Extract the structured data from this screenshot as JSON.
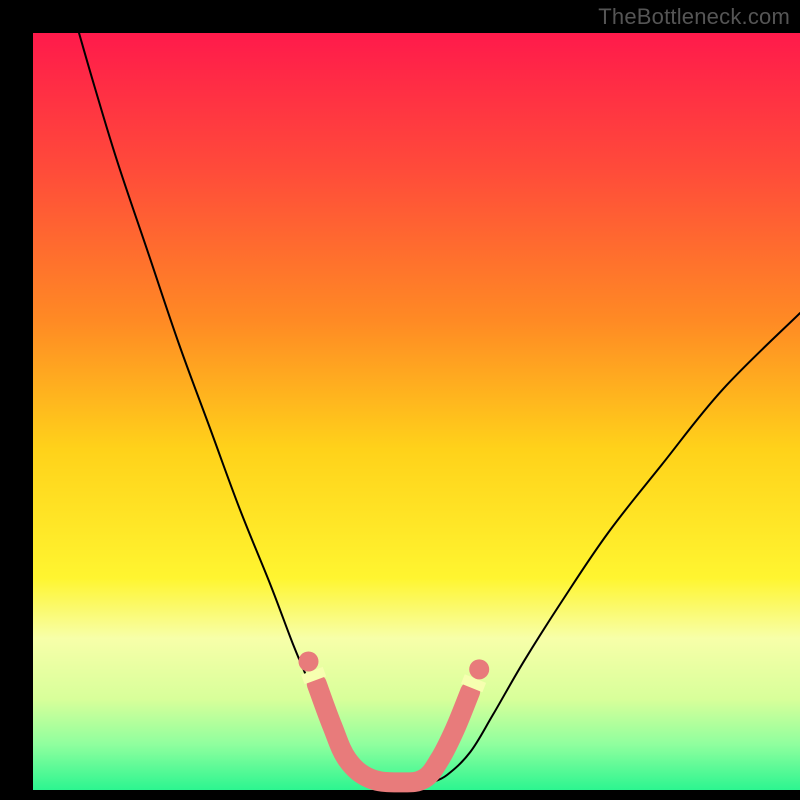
{
  "watermark": "TheBottleneck.com",
  "chart_data": {
    "type": "line",
    "title": "",
    "xlabel": "",
    "ylabel": "",
    "xlim": [
      0,
      100
    ],
    "ylim": [
      0,
      100
    ],
    "background_gradient": {
      "stops": [
        {
          "offset": 0.0,
          "color": "#ff1a4b"
        },
        {
          "offset": 0.18,
          "color": "#ff4b3a"
        },
        {
          "offset": 0.38,
          "color": "#ff8a24"
        },
        {
          "offset": 0.55,
          "color": "#ffd21a"
        },
        {
          "offset": 0.72,
          "color": "#fff530"
        },
        {
          "offset": 0.8,
          "color": "#f7ffa9"
        },
        {
          "offset": 0.88,
          "color": "#d8ff9a"
        },
        {
          "offset": 0.94,
          "color": "#8fff9e"
        },
        {
          "offset": 1.0,
          "color": "#2cf590"
        }
      ]
    },
    "series": [
      {
        "name": "left-curve",
        "type": "curve",
        "color": "#000000",
        "width": 2,
        "points": [
          {
            "x": 6.0,
            "y": 100.0
          },
          {
            "x": 8.0,
            "y": 93.0
          },
          {
            "x": 11.0,
            "y": 83.0
          },
          {
            "x": 15.0,
            "y": 71.0
          },
          {
            "x": 19.0,
            "y": 59.0
          },
          {
            "x": 23.0,
            "y": 48.0
          },
          {
            "x": 27.0,
            "y": 37.0
          },
          {
            "x": 31.0,
            "y": 27.0
          },
          {
            "x": 34.0,
            "y": 19.0
          },
          {
            "x": 36.5,
            "y": 13.0
          },
          {
            "x": 38.5,
            "y": 8.0
          },
          {
            "x": 40.0,
            "y": 5.0
          },
          {
            "x": 42.0,
            "y": 2.0
          },
          {
            "x": 44.0,
            "y": 1.0
          }
        ]
      },
      {
        "name": "right-curve",
        "type": "curve",
        "color": "#000000",
        "width": 2,
        "points": [
          {
            "x": 52.0,
            "y": 1.0
          },
          {
            "x": 54.0,
            "y": 2.0
          },
          {
            "x": 57.0,
            "y": 5.0
          },
          {
            "x": 60.0,
            "y": 10.0
          },
          {
            "x": 64.0,
            "y": 17.0
          },
          {
            "x": 69.0,
            "y": 25.0
          },
          {
            "x": 75.0,
            "y": 34.0
          },
          {
            "x": 82.0,
            "y": 43.0
          },
          {
            "x": 90.0,
            "y": 53.0
          },
          {
            "x": 100.0,
            "y": 63.0
          }
        ]
      },
      {
        "name": "trough-highlight",
        "type": "track",
        "color": "#e87b7b",
        "width": 20,
        "points": [
          {
            "x": 37.0,
            "y": 14.0
          },
          {
            "x": 39.0,
            "y": 8.5
          },
          {
            "x": 41.0,
            "y": 4.0
          },
          {
            "x": 44.0,
            "y": 1.5
          },
          {
            "x": 48.0,
            "y": 1.0
          },
          {
            "x": 51.0,
            "y": 1.5
          },
          {
            "x": 53.0,
            "y": 4.0
          },
          {
            "x": 55.0,
            "y": 8.0
          },
          {
            "x": 57.0,
            "y": 13.0
          }
        ]
      }
    ]
  }
}
